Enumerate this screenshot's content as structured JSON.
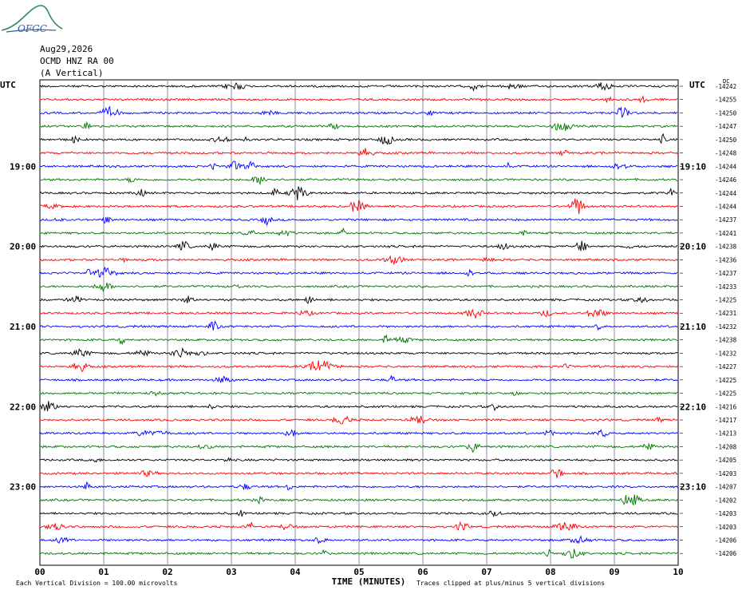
{
  "header": {
    "logo_text": "OFGC",
    "date": "Aug29,2026",
    "station": "OCMD HNZ RA 00",
    "component": "(A Vertical)",
    "utc_left": "UTC",
    "utc_right": "UTC",
    "dc_label": "DC"
  },
  "footer": {
    "scale_note": "Each Vertical Division =  100.00 microvolts",
    "clip_note": "Traces clipped at plus/minus 5 vertical divisions"
  },
  "chart_data": {
    "type": "line",
    "title": "",
    "xlabel": "TIME (MINUTES)",
    "ylabel": "",
    "xlim": [
      0,
      10
    ],
    "x_ticks": [
      "00",
      "01",
      "02",
      "03",
      "04",
      "05",
      "06",
      "07",
      "08",
      "09",
      "10"
    ],
    "trace_colors": [
      "#000000",
      "#ff0000",
      "#0000ff",
      "#007700"
    ],
    "left_hour_labels": [
      "19:00",
      "20:00",
      "21:00",
      "22:00",
      "23:00"
    ],
    "right_hour_labels": [
      "19:10",
      "20:10",
      "21:10",
      "22:10",
      "23:10"
    ],
    "first_hour_label_row": 6,
    "rows_per_hour": 6,
    "dc_offsets": [
      "-14242",
      "-14255",
      "-14250",
      "-14247",
      "-14250",
      "-14248",
      "-14244",
      "-14246",
      "-14244",
      "-14244",
      "-14237",
      "-14241",
      "-14238",
      "-14236",
      "-14237",
      "-14233",
      "-14225",
      "-14231",
      "-14232",
      "-14238",
      "-14232",
      "-14227",
      "-14225",
      "-14225",
      "-14216",
      "-14217",
      "-14213",
      "-14208",
      "-14205",
      "-14203",
      "-14207",
      "-14202",
      "-14203",
      "-14203",
      "-14206",
      "-14206"
    ]
  }
}
